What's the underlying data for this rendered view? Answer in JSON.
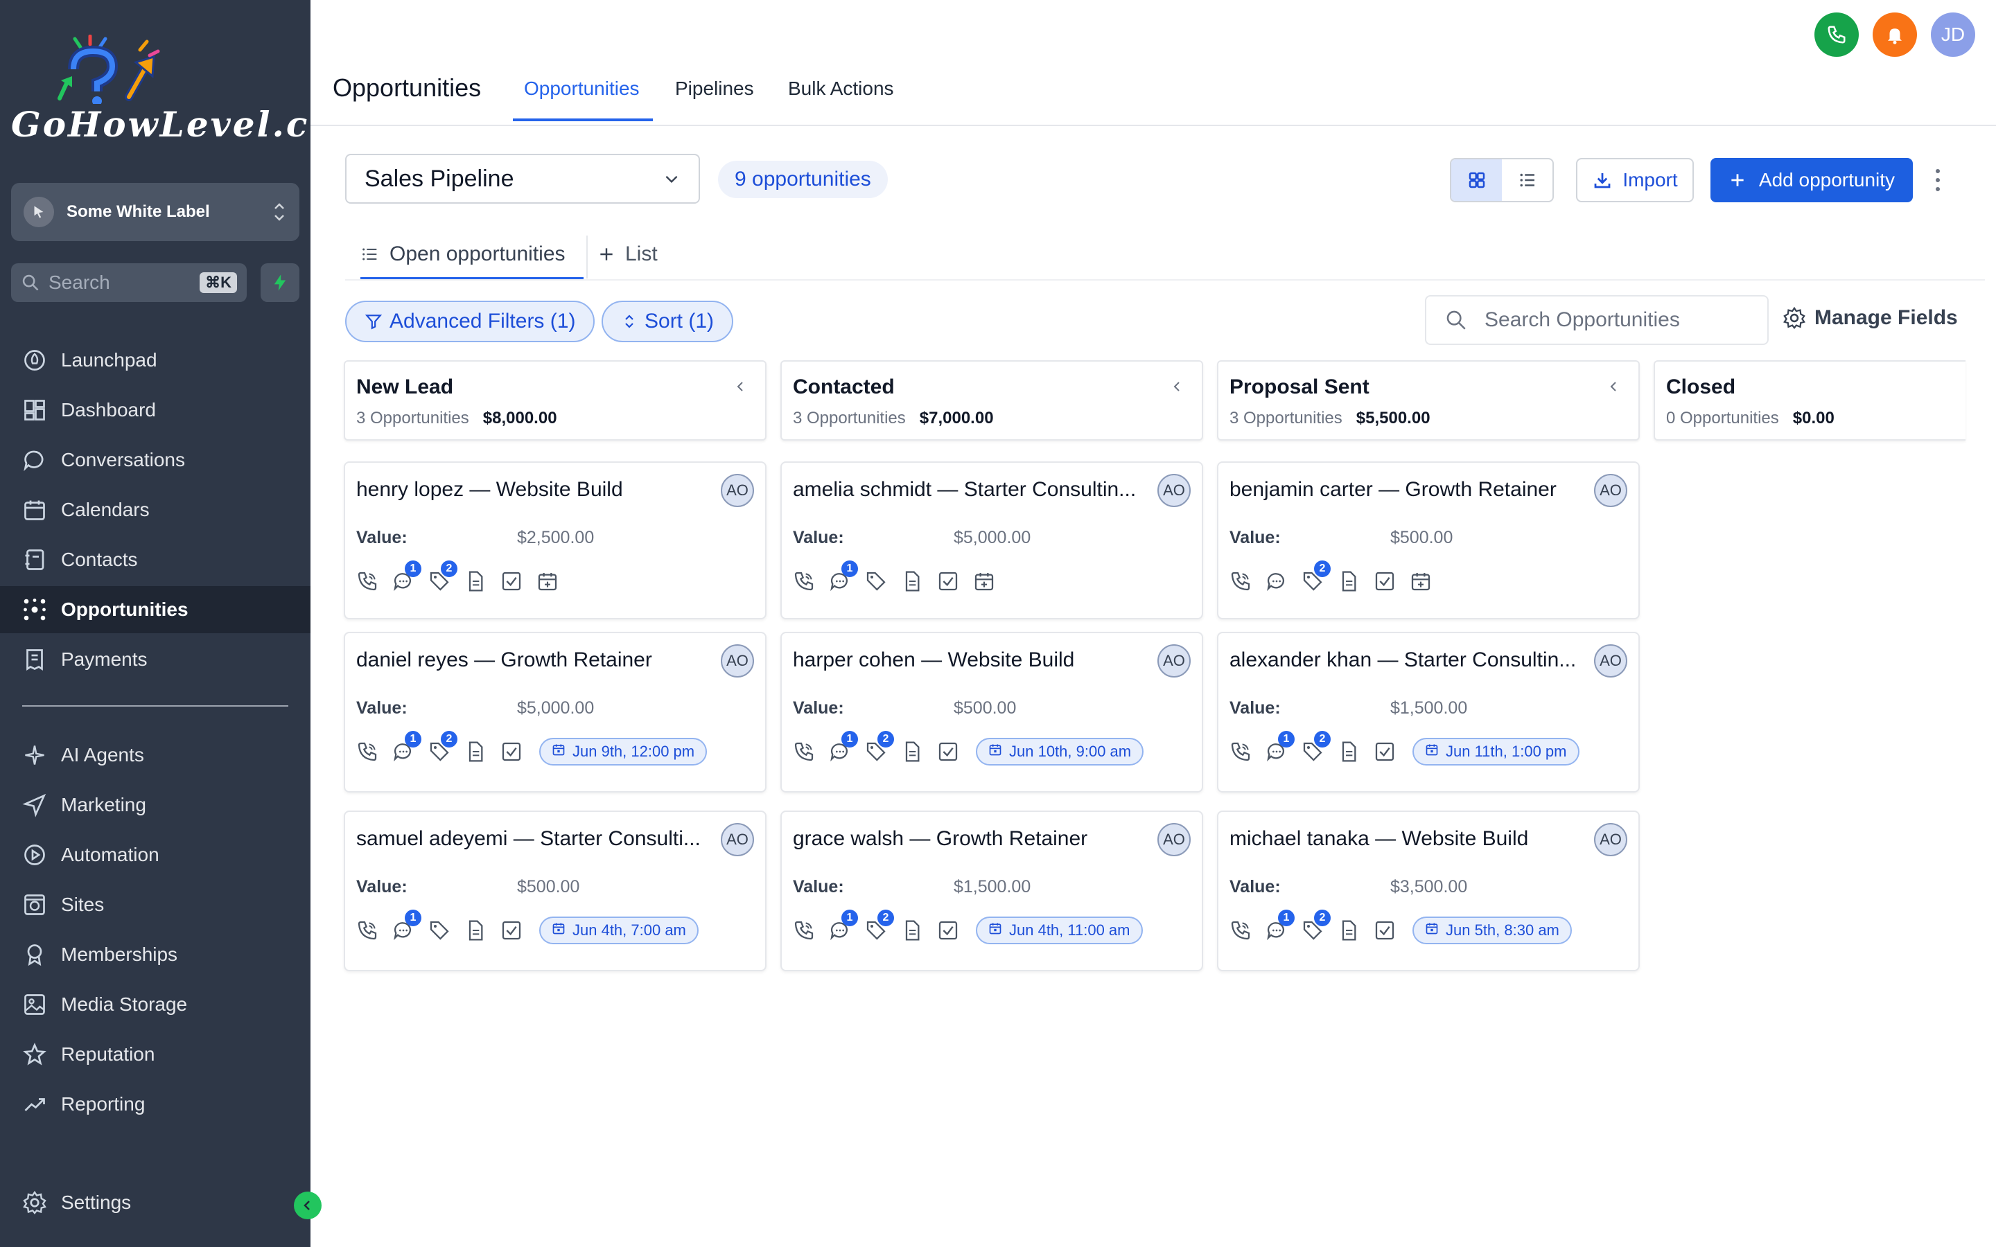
{
  "sidebar": {
    "logo_text": "GoHowLevel.com",
    "account_name": "Some White Label",
    "search_placeholder": "Search",
    "search_shortcut": "⌘K",
    "nav": [
      {
        "label": "Launchpad",
        "icon": "rocket-icon"
      },
      {
        "label": "Dashboard",
        "icon": "grid-icon"
      },
      {
        "label": "Conversations",
        "icon": "chat-icon"
      },
      {
        "label": "Calendars",
        "icon": "calendar-icon"
      },
      {
        "label": "Contacts",
        "icon": "contact-book-icon"
      },
      {
        "label": "Opportunities",
        "icon": "network-icon"
      },
      {
        "label": "Payments",
        "icon": "receipt-icon"
      },
      {
        "label": "AI Agents",
        "icon": "sparkle-icon"
      },
      {
        "label": "Marketing",
        "icon": "send-icon"
      },
      {
        "label": "Automation",
        "icon": "automation-icon"
      },
      {
        "label": "Sites",
        "icon": "globe-icon"
      },
      {
        "label": "Memberships",
        "icon": "badge-icon"
      },
      {
        "label": "Media Storage",
        "icon": "image-icon"
      },
      {
        "label": "Reputation",
        "icon": "star-icon"
      },
      {
        "label": "Reporting",
        "icon": "trend-icon"
      }
    ],
    "settings_label": "Settings"
  },
  "header": {
    "title": "Opportunities",
    "tabs": [
      "Opportunities",
      "Pipelines",
      "Bulk Actions"
    ],
    "active_tab": "Opportunities",
    "user_initials": "JD"
  },
  "toolbar": {
    "pipeline": "Sales Pipeline",
    "count_label": "9 opportunities",
    "import_label": "Import",
    "add_label": "Add opportunity",
    "subtabs": [
      "Open opportunities",
      "List"
    ],
    "filters_label": "Advanced Filters (1)",
    "sort_label": "Sort (1)",
    "search_placeholder": "Search Opportunities",
    "manage_fields_label": "Manage Fields"
  },
  "columns": [
    {
      "title": "New Lead",
      "count": "3 Opportunities",
      "amount": "$8,000.00"
    },
    {
      "title": "Contacted",
      "count": "3 Opportunities",
      "amount": "$7,000.00"
    },
    {
      "title": "Proposal Sent",
      "count": "3 Opportunities",
      "amount": "$5,500.00"
    },
    {
      "title": "Closed",
      "count": "0 Opportunities",
      "amount": "$0.00"
    }
  ],
  "value_label": "Value:",
  "cards": [
    [
      {
        "title": "henry lopez — Website Build",
        "assignee": "AO",
        "value": "$2,500.00",
        "chat_badge": "1",
        "tag_badge": "2",
        "date": ""
      },
      {
        "title": "daniel reyes — Growth Retainer",
        "assignee": "AO",
        "value": "$5,000.00",
        "chat_badge": "1",
        "tag_badge": "2",
        "date": "Jun 9th, 12:00 pm"
      },
      {
        "title": "samuel adeyemi — Starter Consulti...",
        "assignee": "AO",
        "value": "$500.00",
        "chat_badge": "1",
        "tag_badge": "",
        "date": "Jun 4th, 7:00 am"
      }
    ],
    [
      {
        "title": "amelia schmidt — Starter Consultin...",
        "assignee": "AO",
        "value": "$5,000.00",
        "chat_badge": "1",
        "tag_badge": "",
        "date": ""
      },
      {
        "title": "harper cohen — Website Build",
        "assignee": "AO",
        "value": "$500.00",
        "chat_badge": "1",
        "tag_badge": "2",
        "date": "Jun 10th, 9:00 am"
      },
      {
        "title": "grace walsh — Growth Retainer",
        "assignee": "AO",
        "value": "$1,500.00",
        "chat_badge": "1",
        "tag_badge": "2",
        "date": "Jun 4th, 11:00 am"
      }
    ],
    [
      {
        "title": "benjamin carter — Growth Retainer",
        "assignee": "AO",
        "value": "$500.00",
        "chat_badge": "",
        "tag_badge": "2",
        "date": ""
      },
      {
        "title": "alexander khan — Starter Consultin...",
        "assignee": "AO",
        "value": "$1,500.00",
        "chat_badge": "1",
        "tag_badge": "2",
        "date": "Jun 11th, 1:00 pm"
      },
      {
        "title": "michael tanaka — Website Build",
        "assignee": "AO",
        "value": "$3,500.00",
        "chat_badge": "1",
        "tag_badge": "2",
        "date": "Jun 5th, 8:30 am"
      }
    ]
  ]
}
